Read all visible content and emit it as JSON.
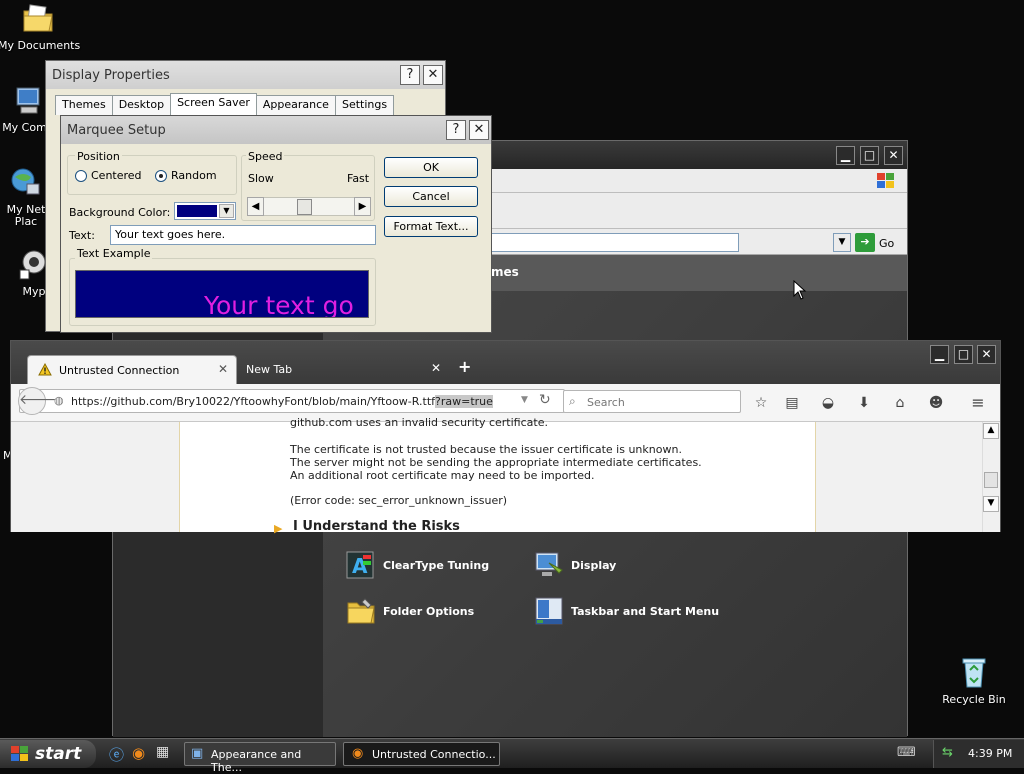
{
  "desktop": {
    "icons": [
      {
        "label": "My Documents"
      },
      {
        "label": "My Comp"
      },
      {
        "label": "My Net"
      },
      {
        "label": "Plac"
      },
      {
        "label": "Myp"
      },
      {
        "label": "M"
      },
      {
        "label": "Recycle Bin"
      }
    ]
  },
  "control_panel": {
    "address_go": "Go",
    "header_title": "mes",
    "items": [
      {
        "label": "ClearType Tuning",
        "icon": "cleartype-icon"
      },
      {
        "label": "Display",
        "icon": "display-icon"
      },
      {
        "label": "Folder Options",
        "icon": "folder-options-icon"
      },
      {
        "label": "Taskbar and Start Menu",
        "icon": "taskbar-icon"
      }
    ]
  },
  "display_properties": {
    "title": "Display Properties",
    "tabs": [
      "Themes",
      "Desktop",
      "Screen Saver",
      "Appearance",
      "Settings"
    ],
    "active_tab": "Screen Saver"
  },
  "marquee": {
    "title": "Marquee Setup",
    "position_label": "Position",
    "centered_label": "Centered",
    "random_label": "Random",
    "selected_position": "Random",
    "speed_label": "Speed",
    "slow_label": "Slow",
    "fast_label": "Fast",
    "bg_color_label": "Background Color:",
    "bg_color": "#00007f",
    "text_label": "Text:",
    "text_value": "Your text goes here.",
    "example_label": "Text Example",
    "example_text": "Your text go",
    "example_text_color": "#e020e0",
    "ok": "OK",
    "cancel": "Cancel",
    "format_text": "Format Text..."
  },
  "firefox": {
    "tabs": [
      {
        "label": "Untrusted Connection",
        "icon": "warning-icon",
        "active": true
      },
      {
        "label": "New Tab",
        "active": false
      }
    ],
    "url_main": "https://github.com/Bry10022/YftoowhyFont/blob/main/Yftoow-R.ttf",
    "url_selected": "?raw=true",
    "search_placeholder": "Search",
    "page": {
      "clipped_line": "github.com uses an invalid security certificate.",
      "lines": [
        "The certificate is not trusted because the issuer certificate is unknown.",
        "The server might not be sending the appropriate intermediate certificates.",
        "An additional root certificate may need to be imported."
      ],
      "error_code": "(Error code: sec_error_unknown_issuer)",
      "risk_heading": "I Understand the Risks"
    }
  },
  "taskbar": {
    "start_label": "start",
    "tasks": [
      {
        "label": "Appearance and The...",
        "icon": "control-panel-icon"
      },
      {
        "label": "Untrusted Connectio...",
        "icon": "firefox-icon"
      }
    ],
    "clock": "4:39 PM"
  }
}
